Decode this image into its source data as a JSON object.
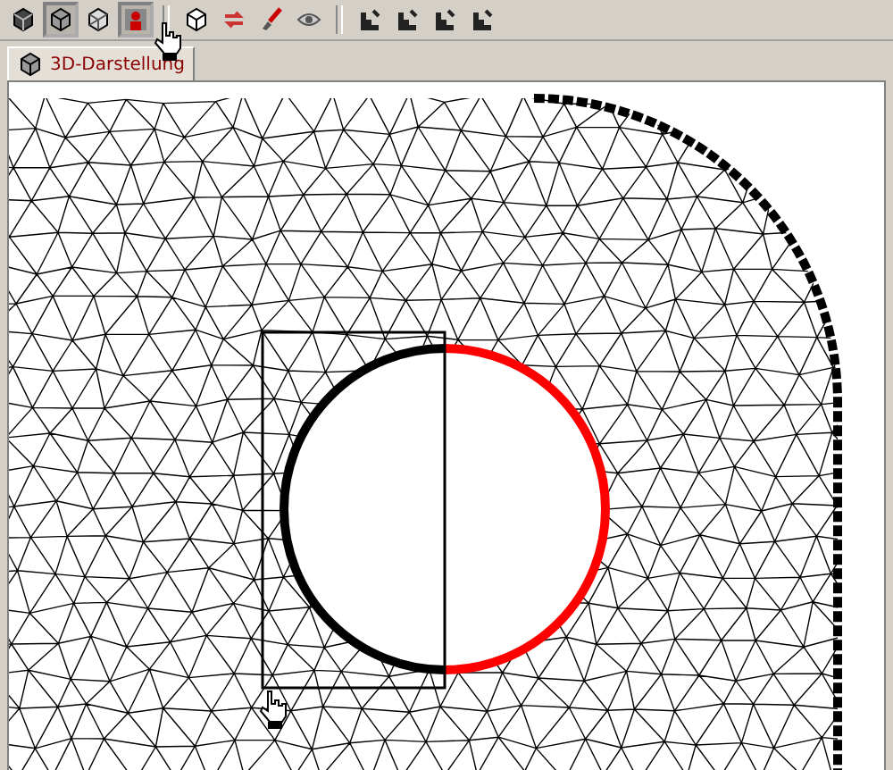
{
  "toolbar": {
    "groups": [
      [
        {
          "kind": "solid-cube",
          "selected": false
        },
        {
          "kind": "shaded-cube",
          "selected": true
        },
        {
          "kind": "wire-cube",
          "selected": false
        },
        {
          "kind": "figure",
          "selected": true
        }
      ],
      [
        {
          "kind": "cube-outline",
          "selected": false
        },
        {
          "kind": "rotate",
          "selected": false
        },
        {
          "kind": "brush",
          "selected": false
        },
        {
          "kind": "eye",
          "selected": false
        }
      ],
      [
        {
          "kind": "step",
          "selected": false
        },
        {
          "kind": "step",
          "selected": false
        },
        {
          "kind": "step",
          "selected": false
        },
        {
          "kind": "step",
          "selected": false
        }
      ]
    ]
  },
  "tabs": [
    {
      "label": "3D-Darstellung",
      "selected": true
    }
  ],
  "hole_edges": [
    {
      "selected": false
    },
    {
      "selected": true
    }
  ]
}
